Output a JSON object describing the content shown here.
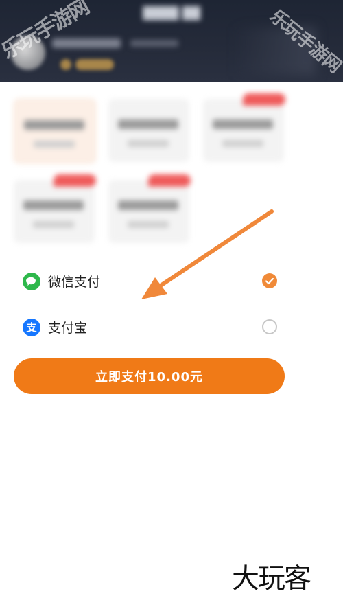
{
  "payment_methods": [
    {
      "label": "微信支付",
      "icon": "wechat-icon",
      "selected": true
    },
    {
      "label": "支付宝",
      "icon": "alipay-icon",
      "icon_glyph": "支",
      "selected": false
    }
  ],
  "pay_button": {
    "label": "立即支付10.00元"
  },
  "watermarks": {
    "top": "乐玩手游网",
    "bottom": "大玩客"
  },
  "colors": {
    "accent": "#f07a17",
    "wechat": "#2eb84b",
    "alipay": "#1677ff",
    "header_bg": "#1e2534",
    "arrow": "#f0883a"
  }
}
